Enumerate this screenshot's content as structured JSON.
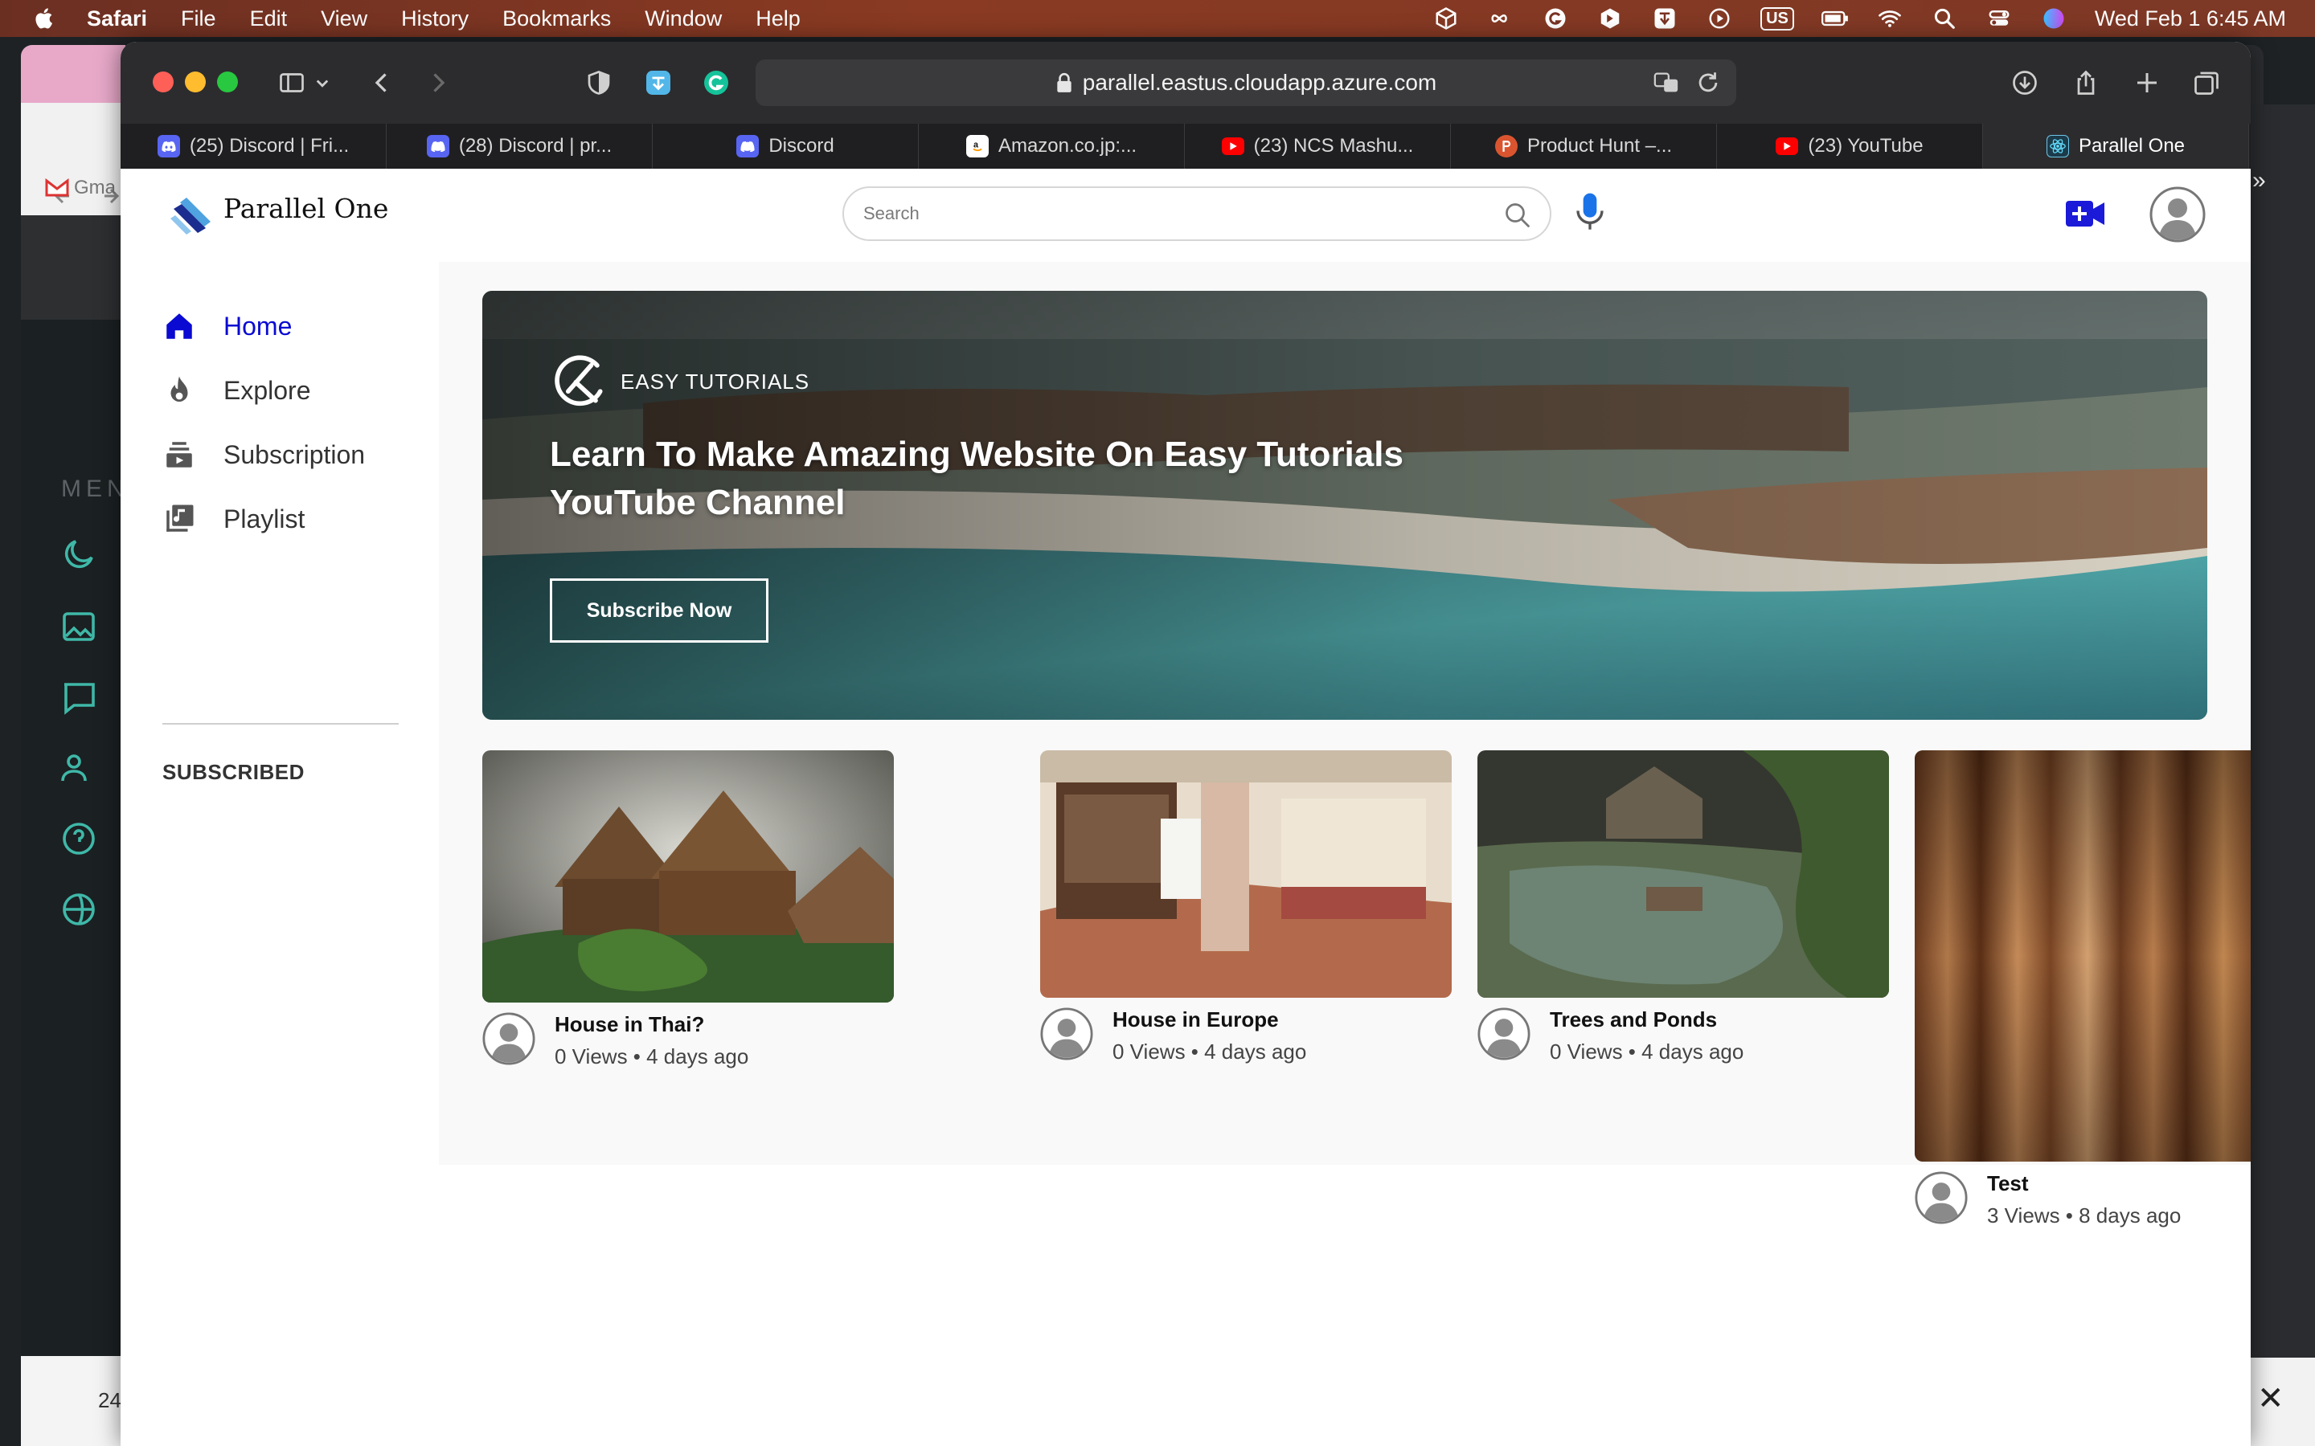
{
  "menubar": {
    "items": [
      "Safari",
      "File",
      "Edit",
      "View",
      "History",
      "Bookmarks",
      "Window",
      "Help"
    ],
    "keyboard_badge": "US",
    "clock": "Wed Feb 1  6:45 AM"
  },
  "browser": {
    "url": "parallel.eastus.cloudapp.azure.com",
    "tabs": [
      {
        "label": "(25) Discord | Fri...",
        "icon": "discord-icon"
      },
      {
        "label": "(28) Discord | pr...",
        "icon": "discord-icon"
      },
      {
        "label": "Discord",
        "icon": "discord-icon"
      },
      {
        "label": "Amazon.co.jp:...",
        "icon": "amazon-icon"
      },
      {
        "label": "(23) NCS Mashu...",
        "icon": "youtube-icon"
      },
      {
        "label": "Product Hunt –...",
        "icon": "producthunt-icon"
      },
      {
        "label": "(23) YouTube",
        "icon": "youtube-icon"
      },
      {
        "label": "Parallel One",
        "icon": "react-icon",
        "active": true
      }
    ]
  },
  "background_app": {
    "menu_label": "MEN",
    "bookmark_label": "Gma",
    "bottom_label": "24"
  },
  "site": {
    "brand": "Parallel One",
    "search": {
      "placeholder": "Search"
    },
    "sidebar": {
      "items": [
        {
          "label": "Home",
          "icon": "home-icon",
          "active": true
        },
        {
          "label": "Explore",
          "icon": "flame-icon"
        },
        {
          "label": "Subscription",
          "icon": "subscription-icon"
        },
        {
          "label": "Playlist",
          "icon": "playlist-icon"
        }
      ],
      "subscribed_heading": "SUBSCRIBED"
    },
    "banner": {
      "logo_text": "EASY TUTORIALS",
      "title": "Learn To Make Amazing Website On Easy Tutorials YouTube Channel",
      "button": "Subscribe Now"
    },
    "videos": [
      {
        "title": "House in Thai?",
        "meta": "0 Views • 4 days ago"
      },
      {
        "title": "House in Europe",
        "meta": "0 Views • 4 days ago"
      },
      {
        "title": "Trees and Ponds",
        "meta": "0 Views • 4 days ago"
      },
      {
        "title": "Test",
        "meta": "3 Views • 8 days ago"
      }
    ]
  },
  "colors": {
    "accent": "#0a0ad2",
    "video_icon": "#1a1ad8",
    "mic_blue": "#1a73e8"
  }
}
